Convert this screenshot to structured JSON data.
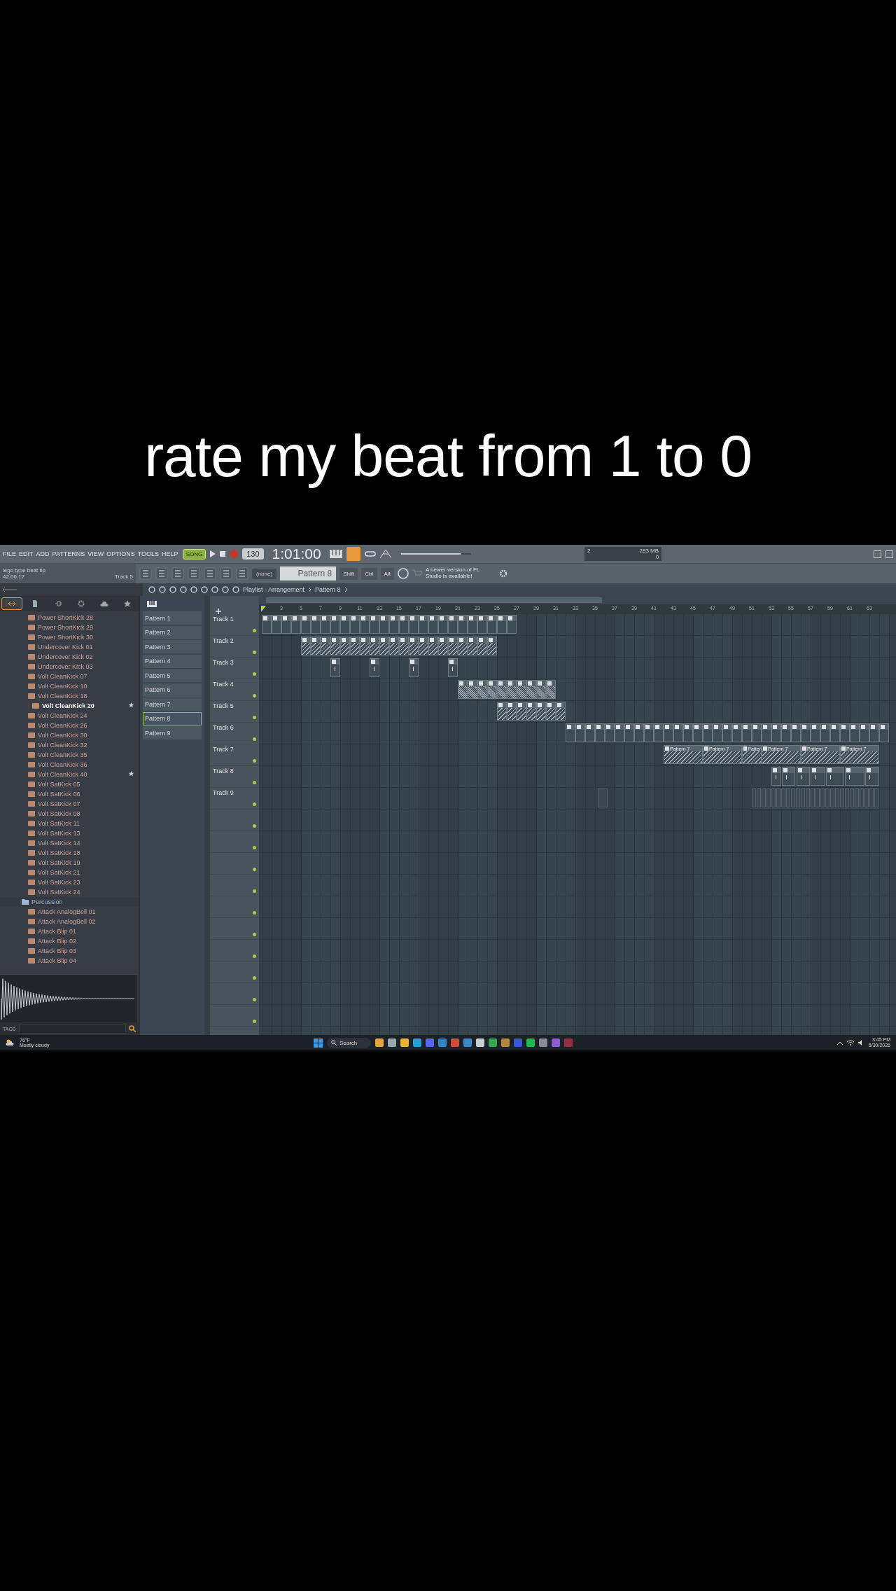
{
  "caption": "rate my beat from 1 to 0",
  "menu": [
    "FILE",
    "EDIT",
    "ADD",
    "PATTERNS",
    "VIEW",
    "OPTIONS",
    "TOOLS",
    "HELP"
  ],
  "transport": {
    "mode": "SONG",
    "tempo": "130",
    "time": "1:01:00",
    "cpu": "2",
    "memory": "283 MB",
    "polyphony": "0",
    "slider": {
      "level": 0.85
    }
  },
  "hint_bar": {
    "project": "lego type beat flp",
    "elapsed": "42:06:17",
    "track": "Track 5"
  },
  "pattern_selector": {
    "arrangement": "(none)",
    "pattern": "Pattern 8"
  },
  "modifiers": [
    "Shift",
    "Ctrl",
    "Alt"
  ],
  "news": "A newer version of FL Studio is available!",
  "playlist": {
    "title": "Playlist - Arrangement",
    "pattern": "Pattern 8"
  },
  "browser": {
    "tabs": [
      {
        "kind": "all",
        "selected": true
      },
      {
        "kind": "file",
        "selected": false
      },
      {
        "kind": "plugin",
        "selected": false
      },
      {
        "kind": "gear",
        "selected": false
      },
      {
        "kind": "cloud",
        "selected": false
      },
      {
        "kind": "star",
        "selected": false
      }
    ],
    "items": [
      {
        "kind": "file",
        "name": "Power ShortKick 28",
        "selected": false,
        "starred": false
      },
      {
        "kind": "file",
        "name": "Power ShortKick 29",
        "selected": false,
        "starred": false
      },
      {
        "kind": "file",
        "name": "Power ShortKick 30",
        "selected": false,
        "starred": false
      },
      {
        "kind": "file",
        "name": "Undercover Kick 01",
        "selected": false,
        "starred": false
      },
      {
        "kind": "file",
        "name": "Undercover Kick 02",
        "selected": false,
        "starred": false
      },
      {
        "kind": "file",
        "name": "Undercover Kick 03",
        "selected": false,
        "starred": false
      },
      {
        "kind": "file",
        "name": "Volt CleanKick 07",
        "selected": false,
        "starred": false
      },
      {
        "kind": "file",
        "name": "Volt CleanKick 10",
        "selected": false,
        "starred": false
      },
      {
        "kind": "file",
        "name": "Volt CleanKick 18",
        "selected": false,
        "starred": false
      },
      {
        "kind": "file",
        "name": "Volt CleanKick 20",
        "selected": true,
        "starred": true
      },
      {
        "kind": "file",
        "name": "Volt CleanKick 24",
        "selected": false,
        "starred": false
      },
      {
        "kind": "file",
        "name": "Volt CleanKick 26",
        "selected": false,
        "starred": false
      },
      {
        "kind": "file",
        "name": "Volt CleanKick 30",
        "selected": false,
        "starred": false
      },
      {
        "kind": "file",
        "name": "Volt CleanKick 32",
        "selected": false,
        "starred": false
      },
      {
        "kind": "file",
        "name": "Volt CleanKick 35",
        "selected": false,
        "starred": false
      },
      {
        "kind": "file",
        "name": "Volt CleanKick 36",
        "selected": false,
        "starred": false
      },
      {
        "kind": "file",
        "name": "Volt CleanKick 40",
        "selected": false,
        "starred": true
      },
      {
        "kind": "file",
        "name": "Volt SatKick 05",
        "selected": false,
        "starred": false
      },
      {
        "kind": "file",
        "name": "Volt SatKick 06",
        "selected": false,
        "starred": false
      },
      {
        "kind": "file",
        "name": "Volt SatKick 07",
        "selected": false,
        "starred": false
      },
      {
        "kind": "file",
        "name": "Volt SatKick 08",
        "selected": false,
        "starred": false
      },
      {
        "kind": "file",
        "name": "Volt SatKick 11",
        "selected": false,
        "starred": false
      },
      {
        "kind": "file",
        "name": "Volt SatKick 13",
        "selected": false,
        "starred": false
      },
      {
        "kind": "file",
        "name": "Volt SatKick 14",
        "selected": false,
        "starred": false
      },
      {
        "kind": "file",
        "name": "Volt SatKick 18",
        "selected": false,
        "starred": false
      },
      {
        "kind": "file",
        "name": "Volt SatKick 19",
        "selected": false,
        "starred": false
      },
      {
        "kind": "file",
        "name": "Volt SatKick 21",
        "selected": false,
        "starred": false
      },
      {
        "kind": "file",
        "name": "Volt SatKick 23",
        "selected": false,
        "starred": false
      },
      {
        "kind": "file",
        "name": "Volt SatKick 24",
        "selected": false,
        "starred": false
      },
      {
        "kind": "folder",
        "name": "Percussion",
        "selected": false,
        "starred": false
      },
      {
        "kind": "file",
        "name": "Attack AnalogBell 01",
        "selected": false,
        "starred": false
      },
      {
        "kind": "file",
        "name": "Attack AnalogBell 02",
        "selected": false,
        "starred": false
      },
      {
        "kind": "file",
        "name": "Attack Blip 01",
        "selected": false,
        "starred": false
      },
      {
        "kind": "file",
        "name": "Attack Blip 02",
        "selected": false,
        "starred": false
      },
      {
        "kind": "file",
        "name": "Attack Blip 03",
        "selected": false,
        "starred": false
      },
      {
        "kind": "file",
        "name": "Attack Blip 04",
        "selected": false,
        "starred": false
      }
    ],
    "tags_label": "TAGS"
  },
  "patterns": [
    {
      "name": "Pattern 1",
      "selected": false
    },
    {
      "name": "Pattern 2",
      "selected": false
    },
    {
      "name": "Pattern 3",
      "selected": false
    },
    {
      "name": "Pattern 4",
      "selected": false
    },
    {
      "name": "Pattern 5",
      "selected": false
    },
    {
      "name": "Pattern 6",
      "selected": false
    },
    {
      "name": "Pattern 7",
      "selected": false
    },
    {
      "name": "Pattern 8",
      "selected": true
    },
    {
      "name": "Pattern 9",
      "selected": false
    }
  ],
  "ruler": [
    "3",
    "5",
    "7",
    "9",
    "11",
    "13",
    "15",
    "17",
    "19",
    "21",
    "23",
    "25",
    "27",
    "29",
    "31",
    "33",
    "35",
    "37",
    "39",
    "41",
    "43",
    "45",
    "47",
    "49",
    "51",
    "53",
    "55",
    "57",
    "59",
    "61",
    "63"
  ],
  "tracks": [
    {
      "name": "Track 1"
    },
    {
      "name": "Track 2"
    },
    {
      "name": "Track 3"
    },
    {
      "name": "Track 4"
    },
    {
      "name": "Track 5"
    },
    {
      "name": "Track 6"
    },
    {
      "name": "Track 7",
      "clips": [
        "Pattern 7",
        "Pattern 7",
        "Patter",
        "Pattern 7",
        "Pattern 7",
        "Pattern 7"
      ]
    },
    {
      "name": "Track 8"
    },
    {
      "name": "Track 9"
    }
  ],
  "taskbar": {
    "temperature": "76°F",
    "weather": "Mostly cloudy",
    "search": "Search",
    "time": "3:45 PM",
    "date": "5/30/2026"
  }
}
